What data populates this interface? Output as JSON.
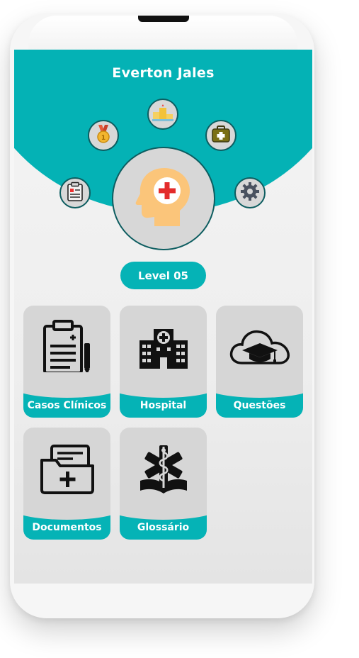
{
  "profile": {
    "name": "Everton Jales",
    "level": "Level 05"
  },
  "orbit_icons": [
    {
      "name": "clipboard-icon"
    },
    {
      "name": "medal-icon"
    },
    {
      "name": "podium-icon"
    },
    {
      "name": "first-aid-kit-icon"
    },
    {
      "name": "gear-icon"
    }
  ],
  "menu": {
    "items": [
      {
        "label": "Casos Clínicos",
        "icon": "clipboard-pen-icon"
      },
      {
        "label": "Hospital",
        "icon": "hospital-building-icon"
      },
      {
        "label": "Questões",
        "icon": "cloud-graduation-cap-icon"
      },
      {
        "label": "Documentos",
        "icon": "folder-plus-icon"
      },
      {
        "label": "Glossário",
        "icon": "medical-book-icon"
      }
    ]
  },
  "colors": {
    "accent": "#04b2b5",
    "tile_background": "#d6d6d6",
    "ring": "#0d5d60"
  }
}
